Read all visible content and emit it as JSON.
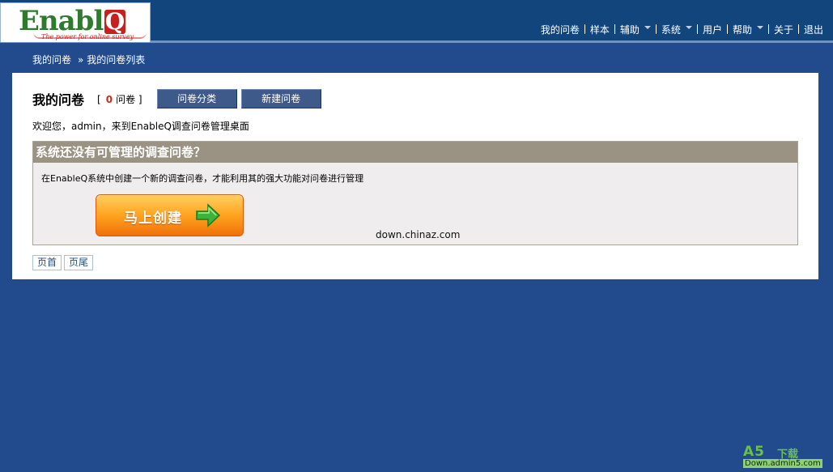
{
  "logo": {
    "brand": "Enable",
    "brand_q": "Q",
    "tagline": "The power for online survey"
  },
  "nav": {
    "items": [
      {
        "label": "我的问卷",
        "has_dropdown": false
      },
      {
        "label": "样本",
        "has_dropdown": false
      },
      {
        "label": "辅助",
        "has_dropdown": true
      },
      {
        "label": "系统",
        "has_dropdown": true
      },
      {
        "label": "用户",
        "has_dropdown": false
      },
      {
        "label": "帮助",
        "has_dropdown": true
      },
      {
        "label": "关于",
        "has_dropdown": false
      },
      {
        "label": "退出",
        "has_dropdown": false
      }
    ]
  },
  "breadcrumb": {
    "root": "我的问卷",
    "separator": "»",
    "current": "我的问卷列表"
  },
  "main": {
    "title": "我的问卷",
    "count_open": "[",
    "count": "0",
    "count_unit": "问卷",
    "count_close": "]",
    "category_button": "问卷分类",
    "new_button": "新建问卷",
    "welcome": "欢迎您，admin，来到EnableQ调查问卷管理桌面"
  },
  "empty_box": {
    "heading": "系统还没有可管理的调查问卷？",
    "description": "在EnableQ系统中创建一个新的调查问卷，才能利用其的强大功能对问卷进行管理",
    "create_button": "马上创建",
    "watermark": "down.chinaz.com"
  },
  "pager": {
    "first": "页首",
    "last": "页尾"
  },
  "corner_logo": {
    "brand": "A5",
    "download": "下载",
    "url": "Down.admin5.com"
  },
  "colors": {
    "background": "#214b8c",
    "header": "#13457d",
    "accent_red": "#c32b1b",
    "box_header": "#9a9282",
    "button": "#3d5a8a",
    "create_orange": "#ffa31f"
  }
}
